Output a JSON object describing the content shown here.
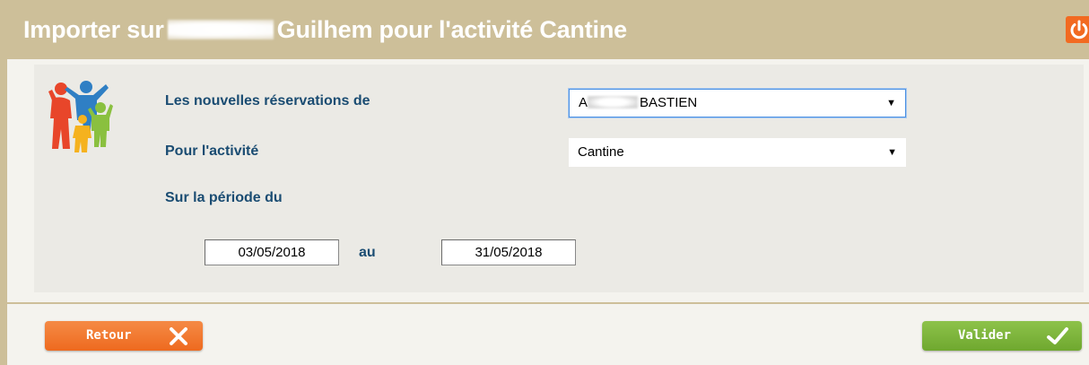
{
  "window": {
    "title_prefix": "Importer sur",
    "title_suffix": "Guilhem pour l'activité Cantine"
  },
  "form": {
    "reservations_label": "Les nouvelles réservations de",
    "reservations_value_visible": "BASTIEN",
    "activity_label": "Pour l'activité",
    "activity_value": "Cantine",
    "period_label": "Sur la période du",
    "date_from": "03/05/2018",
    "to_label": "au",
    "date_to": "31/05/2018"
  },
  "buttons": {
    "back_label": "Retour",
    "validate_label": "Valider"
  },
  "icons": {
    "power": "power-icon",
    "family": "family-icon",
    "close": "close-x-icon",
    "check": "checkmark-icon",
    "dropdown": "dropdown-arrow-icon"
  },
  "colors": {
    "header_bg": "#cdbf99",
    "label_text": "#1a4c72",
    "back_button": "#ee6a1f",
    "validate_button": "#6fa82f",
    "power_button": "#f26a21"
  }
}
